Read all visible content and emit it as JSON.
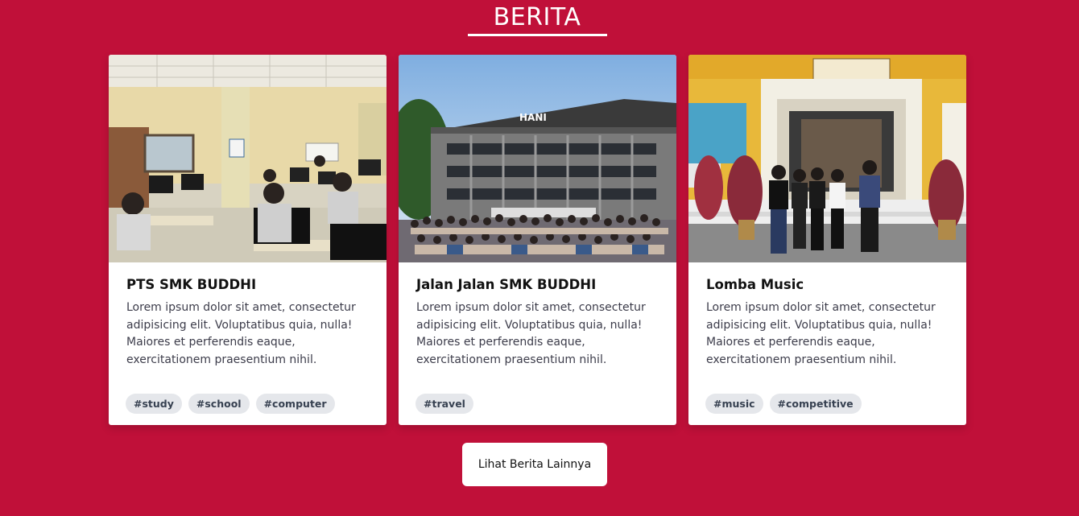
{
  "section": {
    "title": "BERITA"
  },
  "colors": {
    "background": "#c01039",
    "card": "#ffffff",
    "tag_background": "#e5e7eb"
  },
  "cards": [
    {
      "image": "classroom-photo",
      "title": "PTS SMK BUDDHI",
      "text": "Lorem ipsum dolor sit amet, consectetur adipisicing elit. Voluptatibus quia, nulla! Maiores et perferendis eaque, exercitationem praesentium nihil.",
      "tags": [
        "#study",
        "#school",
        "#computer"
      ]
    },
    {
      "image": "hotel-group-photo",
      "title": "Jalan Jalan SMK BUDDHI",
      "text": "Lorem ipsum dolor sit amet, consectetur adipisicing elit. Voluptatibus quia, nulla! Maiores et perferendis eaque, exercitationem praesentium nihil.",
      "tags": [
        "#travel"
      ]
    },
    {
      "image": "school-entrance-photo",
      "title": "Lomba Music",
      "text": "Lorem ipsum dolor sit amet, consectetur adipisicing elit. Voluptatibus quia, nulla! Maiores et perferendis eaque, exercitationem praesentium nihil.",
      "tags": [
        "#music",
        "#competitive"
      ]
    }
  ],
  "more_button": {
    "label": "Lihat Berita Lainnya"
  }
}
